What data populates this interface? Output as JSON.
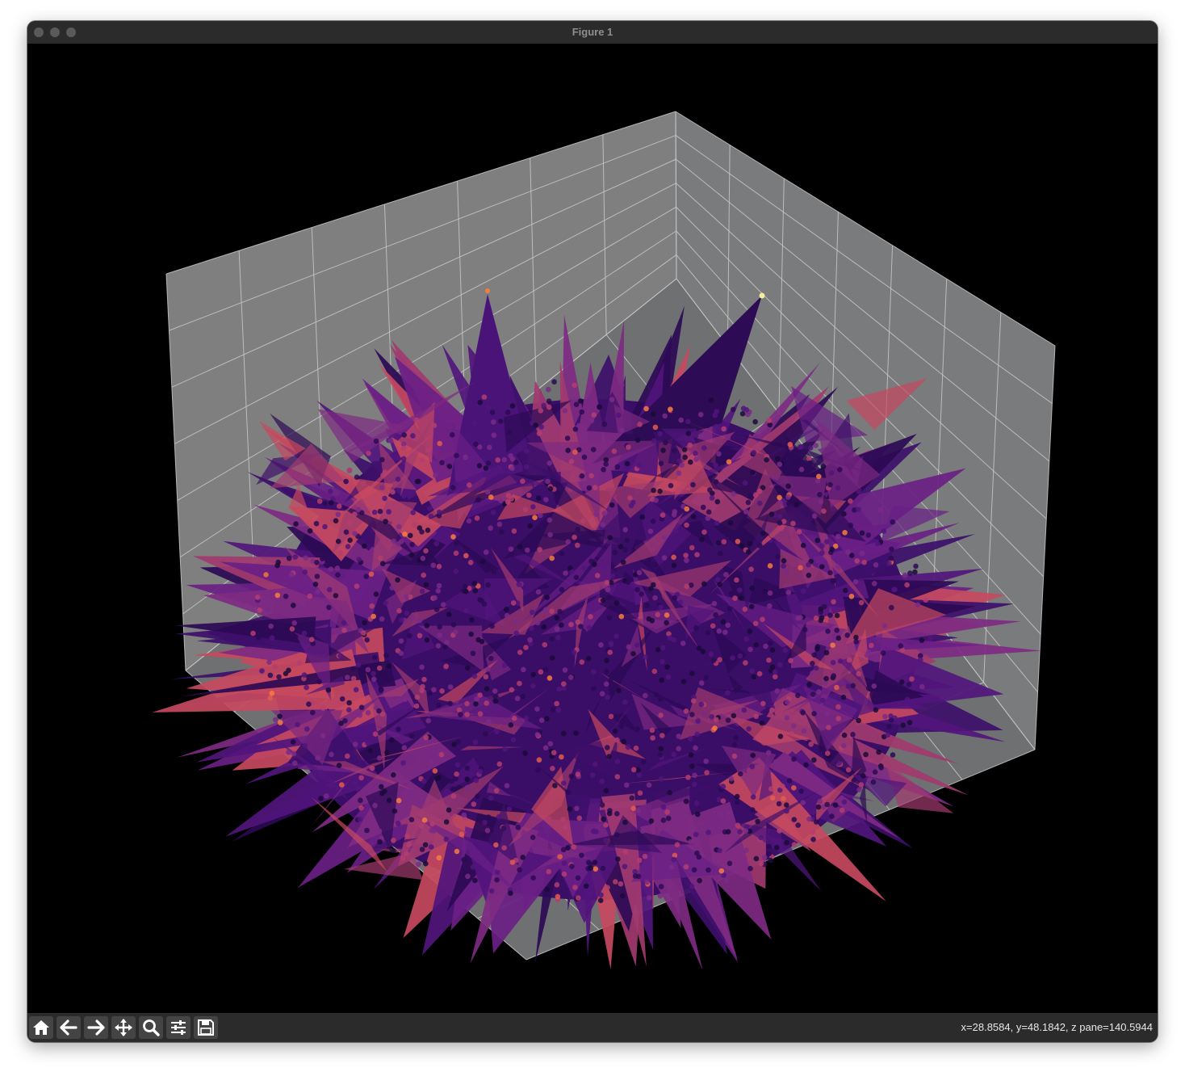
{
  "window": {
    "title": "Figure 1"
  },
  "toolbar": {
    "buttons": [
      {
        "name": "home-button",
        "icon": "home-icon",
        "tooltip": "Reset original view"
      },
      {
        "name": "back-button",
        "icon": "arrow-left-icon",
        "tooltip": "Back to previous view"
      },
      {
        "name": "forward-button",
        "icon": "arrow-right-icon",
        "tooltip": "Forward to next view"
      },
      {
        "name": "pan-button",
        "icon": "move-icon",
        "tooltip": "Pan axes"
      },
      {
        "name": "zoom-button",
        "icon": "magnifier-icon",
        "tooltip": "Zoom to rectangle"
      },
      {
        "name": "configure-subplots-button",
        "icon": "sliders-icon",
        "tooltip": "Configure subplots"
      },
      {
        "name": "save-button",
        "icon": "floppy-disk-icon",
        "tooltip": "Save the figure"
      }
    ]
  },
  "status": {
    "coords": "x=28.8584, y=48.1842, z pane=140.5944"
  },
  "plot": {
    "type": "3d scatter with triangulated surface",
    "background": "#000000",
    "pane_color": "#7f7f7f",
    "grid_color": "#c8c8c8",
    "colormap": "magma",
    "surface_colors": [
      "#2c0a55",
      "#3d0f6a",
      "#51157c",
      "#6a1f86",
      "#7e2a82",
      "#a13a6f",
      "#c6495f"
    ],
    "point_colors": [
      "#1a0b3a",
      "#2c0a55",
      "#51157c",
      "#7a2a87",
      "#b33d6f",
      "#e25c4d",
      "#f77b3e",
      "#f2f09a"
    ]
  }
}
